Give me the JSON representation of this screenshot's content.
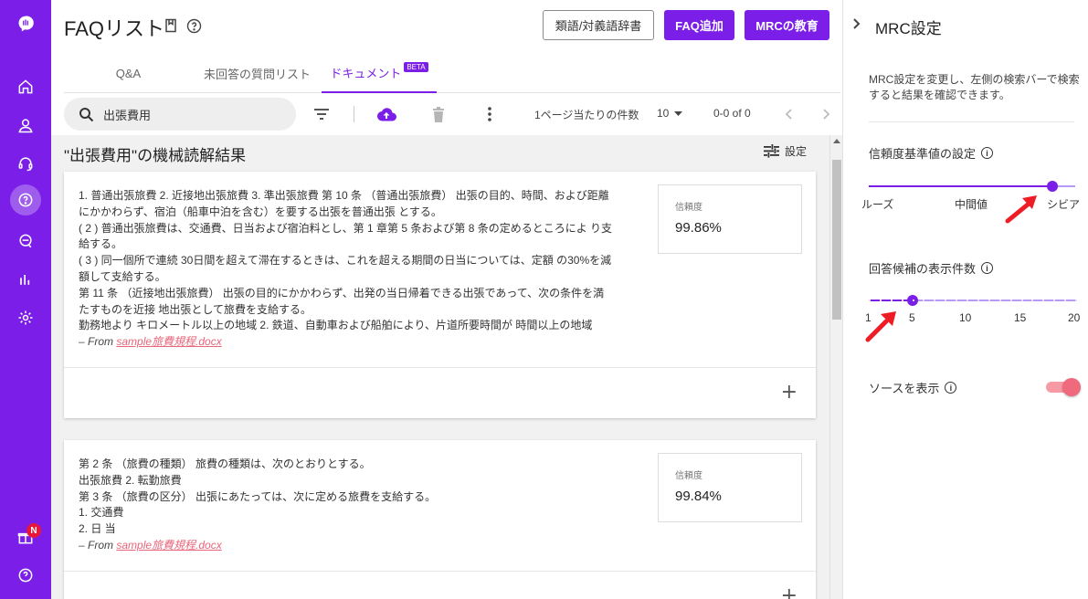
{
  "page": {
    "title": "FAQリスト",
    "buttons": {
      "synonym_dict": "類語/対義語辞書",
      "add_faq": "FAQ追加",
      "mrc_training": "MRCの教育"
    }
  },
  "tabs": [
    {
      "label": "Q&A"
    },
    {
      "label": "未回答の質問リスト"
    },
    {
      "label": "ドキュメント",
      "badge": "BETA"
    }
  ],
  "toolbar": {
    "search_value": "出張費用",
    "per_page_label": "1ページ当たりの件数",
    "per_page_value": "10",
    "range": "0-0 of 0"
  },
  "results": {
    "heading": "\"出張費用\"の機械読解結果",
    "settings_label": "設定",
    "score_label": "信頼度",
    "from_prefix": "– From",
    "cards": [
      {
        "lines": [
          "1. 普通出張旅費 2. 近接地出張旅費 3. 準出張旅費 第 10 条 （普通出張旅費） 出張の目的、時間、および距離",
          "にかかわらず、宿泊（船車中泊を含む）を要する出張を普通出張 とする。",
          "( 2 ) 普通出張旅費は、交通費、日当および宿泊料とし、第 1 章第 5 条および第 8 条の定めるところによ り支",
          "給する。",
          "( 3 ) 同一個所で連続 30日間を超えて滞在するときは、これを超える期間の日当については、定額 の30%を減",
          "額して支給する。",
          "第 11 条 （近接地出張旅費） 出張の目的にかかわらず、出発の当日帰着できる出張であって、次の条件を満",
          "たすものを近接 地出張として旅費を支給する。",
          "勤務地より キロメートル以上の地域 2. 鉄道、自動車および船舶により、片道所要時間が 時間以上の地域"
        ],
        "source": "sample旅費規程.docx",
        "score": "99.86%"
      },
      {
        "lines": [
          "第 2 条 （旅費の種類） 旅費の種類は、次のとおりとする。",
          "出張旅費 2. 転勤旅費",
          "第 3 条 （旅費の区分） 出張にあたっては、次に定める旅費を支給する。",
          "1. 交通費",
          "2. 日 当"
        ],
        "source": "sample旅費規程.docx",
        "score": "99.84%"
      }
    ]
  },
  "panel": {
    "title": "MRC設定",
    "description": "MRC設定を変更し、左側の検索バーで検索すると結果を確認できます。",
    "threshold": {
      "label": "信頼度基準値の設定",
      "levels": [
        "ルーズ",
        "中間値",
        "シビア"
      ],
      "value_fraction": 0.89
    },
    "count": {
      "label": "回答候補の表示件数",
      "ticks": [
        "1",
        "5",
        "10",
        "15",
        "20"
      ],
      "value": 5
    },
    "show_source": {
      "label": "ソースを表示",
      "on": true
    }
  },
  "sidebar": {
    "notification_badge": "N"
  },
  "colors": {
    "brand": "#7b1fe8",
    "link": "#e8667a",
    "toggle": "#f06a7e"
  }
}
